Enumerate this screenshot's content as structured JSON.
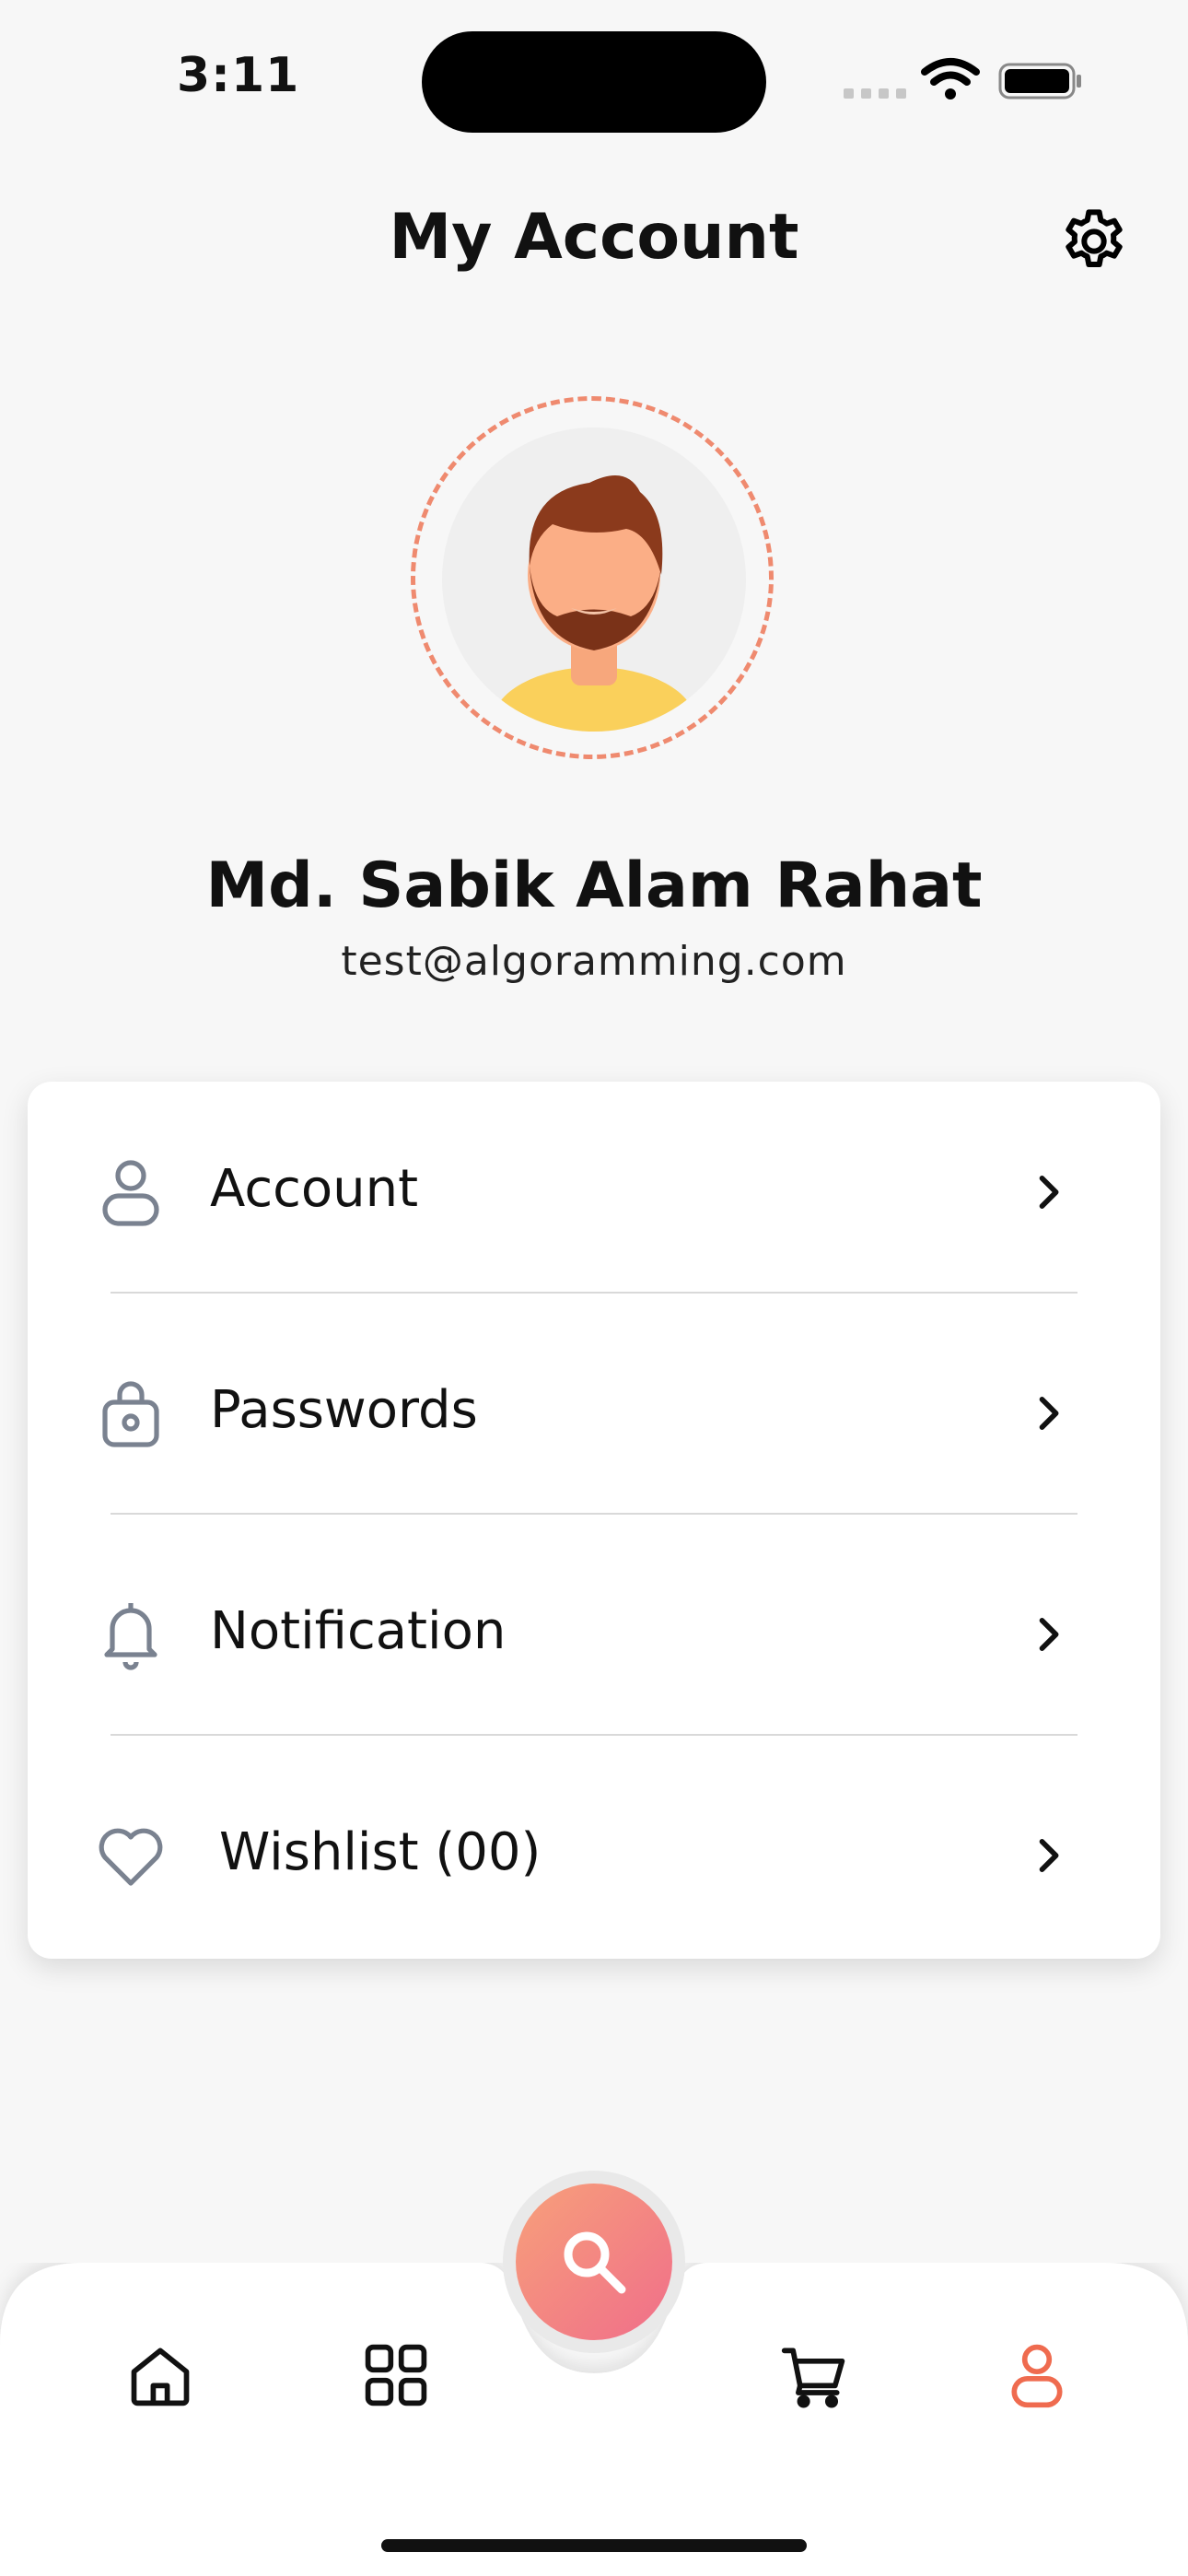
{
  "status_bar": {
    "time": "3:11"
  },
  "header": {
    "title": "My Account",
    "settings_icon": "gear-icon"
  },
  "profile": {
    "name": "Md. Sabik Alam Rahat",
    "email": "test@algoramming.com"
  },
  "menu": {
    "items": [
      {
        "label": "Account",
        "icon": "user-icon"
      },
      {
        "label": "Passwords",
        "icon": "lock-icon"
      },
      {
        "label": "Notification",
        "icon": "bell-icon"
      },
      {
        "label": "Wishlist (00)",
        "icon": "heart-icon"
      }
    ]
  },
  "bottom_nav": {
    "items": [
      {
        "icon": "home-icon"
      },
      {
        "icon": "grid-icon"
      },
      {
        "icon": "search-icon",
        "primary": true
      },
      {
        "icon": "cart-icon"
      },
      {
        "icon": "profile-icon",
        "active": true
      }
    ],
    "active_color": "#ef6b4f",
    "fab_gradient": [
      "#f7a07a",
      "#f06e8a"
    ]
  },
  "colors": {
    "accent": "#ef8a6f",
    "background": "#f7f7f7",
    "card": "#ffffff",
    "icon_gray": "#7a8290"
  }
}
